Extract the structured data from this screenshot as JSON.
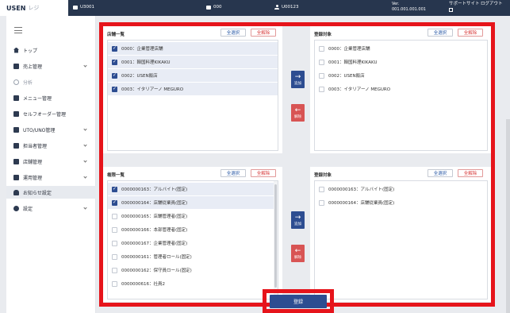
{
  "topbar": {
    "logo": "USEN",
    "logo_sub": "レジ",
    "store": "U3001",
    "terminal": "000",
    "user": "U00123",
    "version_label": "Ver.",
    "version": "001.001.001.001",
    "support_label": "サポートサイト",
    "logout_label": "ログアウト"
  },
  "sidebar": {
    "items": [
      {
        "label": "トップ",
        "icon": "home-icon"
      },
      {
        "label": "売上管理",
        "icon": "chart-icon"
      },
      {
        "label": "分析",
        "icon": "analysis-icon"
      },
      {
        "label": "メニュー管理",
        "icon": "menu-icon"
      },
      {
        "label": "セルフオーダー管理",
        "icon": "self-order-icon"
      },
      {
        "label": "UTO/UNO管理",
        "icon": "uto-icon"
      },
      {
        "label": "担当者管理",
        "icon": "staff-icon"
      },
      {
        "label": "店舗管理",
        "icon": "store-icon"
      },
      {
        "label": "運用管理",
        "icon": "operation-icon"
      },
      {
        "label": "お知らせ設定",
        "icon": "bell-icon"
      },
      {
        "label": "設定",
        "icon": "gear-icon"
      }
    ]
  },
  "stores_panel": {
    "title": "店舗一覧",
    "select_all": "全選択",
    "deselect_all": "全解除",
    "items": [
      {
        "label": "0000：企業管理店舗",
        "checked": true
      },
      {
        "label": "0001：韓国料理KIKAKU",
        "checked": true
      },
      {
        "label": "0002：USEN飯店",
        "checked": true
      },
      {
        "label": "0003：イタリアーノ MEGURO",
        "checked": true
      }
    ]
  },
  "stores_target": {
    "title": "登録対象",
    "select_all": "全選択",
    "deselect_all": "全解除",
    "items": [
      {
        "label": "0000：企業管理店舗",
        "checked": false
      },
      {
        "label": "0001：韓国料理KIKAKU",
        "checked": false
      },
      {
        "label": "0002：USEN飯店",
        "checked": false
      },
      {
        "label": "0003：イタリアーノ MEGURO",
        "checked": false
      }
    ]
  },
  "roles_panel": {
    "title": "権限一覧",
    "select_all": "全選択",
    "deselect_all": "全解除",
    "items": [
      {
        "label": "0000000163：アルバイト(固定)",
        "checked": true
      },
      {
        "label": "0000000164：店舗従業員(固定)",
        "checked": true
      },
      {
        "label": "0000000165：店舗管理者(固定)",
        "checked": false
      },
      {
        "label": "0000000166：本部管理者(固定)",
        "checked": false
      },
      {
        "label": "0000000167：企業管理者(固定)",
        "checked": false
      },
      {
        "label": "0000000161：管理者ロール(固定)",
        "checked": false
      },
      {
        "label": "0000000162：保守員ロール(固定)",
        "checked": false
      },
      {
        "label": "0000000616：社員2",
        "checked": false
      }
    ]
  },
  "roles_target": {
    "title": "登録対象",
    "select_all": "全選択",
    "deselect_all": "全解除",
    "items": [
      {
        "label": "0000000163：アルバイト(固定)",
        "checked": false
      },
      {
        "label": "0000000164：店舗従業員(固定)",
        "checked": false
      }
    ]
  },
  "move": {
    "add_label": "追加",
    "remove_label": "解除",
    "add_arrow": "→",
    "remove_arrow": "←"
  },
  "save_label": "登録",
  "colors": {
    "highlight": "#e6141b",
    "primary": "#2d4d91",
    "danger": "#d85454",
    "topbar": "#27364e"
  }
}
